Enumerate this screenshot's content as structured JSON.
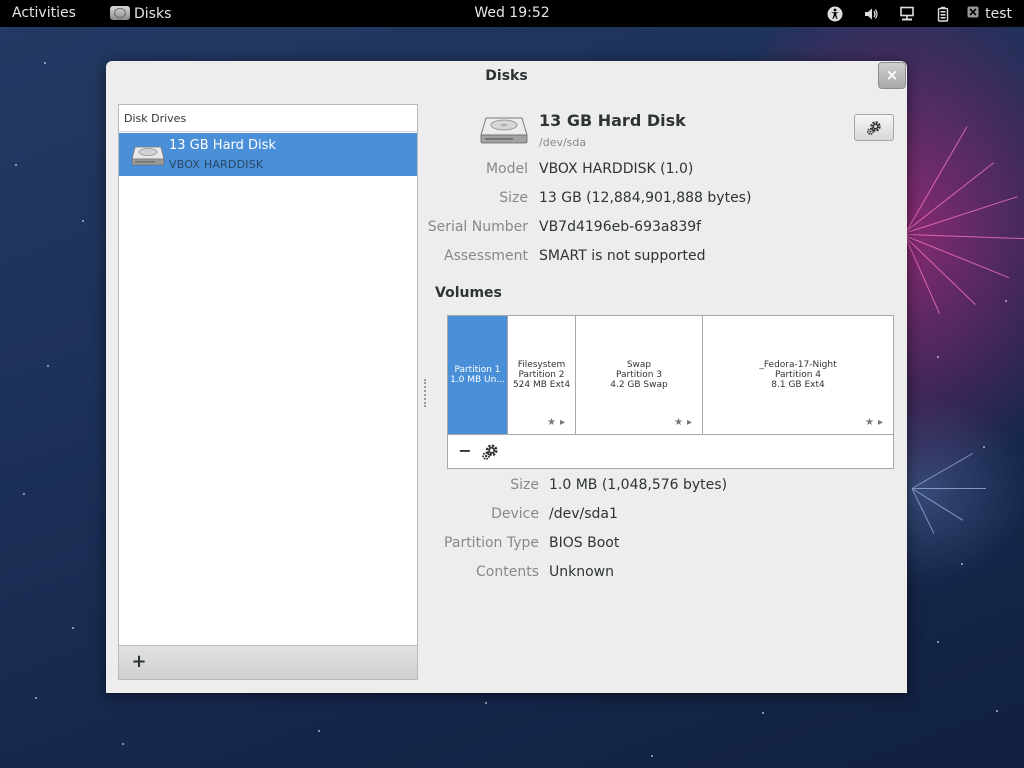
{
  "topbar": {
    "activities": "Activities",
    "app_name": "Disks",
    "clock": "Wed 19:52",
    "user": "test",
    "icons": [
      "accessibility-icon",
      "volume-icon",
      "network-icon",
      "battery-icon"
    ]
  },
  "window": {
    "title": "Disks",
    "close_label": "×"
  },
  "sidebar": {
    "header": "Disk Drives",
    "drives": [
      {
        "name": "13 GB Hard Disk",
        "model": "VBOX HARDDISK"
      }
    ],
    "add_label": "+"
  },
  "drive": {
    "title": "13 GB Hard Disk",
    "device": "/dev/sda",
    "properties": [
      {
        "label": "Model",
        "value": "VBOX HARDDISK (1.0)"
      },
      {
        "label": "Size",
        "value": "13 GB (12,884,901,888 bytes)"
      },
      {
        "label": "Serial Number",
        "value": "VB7d4196eb-693a839f"
      },
      {
        "label": "Assessment",
        "value": "SMART is not supported"
      }
    ]
  },
  "volumes": {
    "title": "Volumes",
    "partitions": [
      {
        "line1": "Partition 1",
        "line2": "1.0 MB Un...",
        "line3": "",
        "selected": true
      },
      {
        "line1": "Filesystem",
        "line2": "Partition 2",
        "line3": "524 MB Ext4",
        "selected": false
      },
      {
        "line1": "Swap",
        "line2": "Partition 3",
        "line3": "4.2 GB Swap",
        "selected": false
      },
      {
        "line1": "_Fedora-17-Night",
        "line2": "Partition 4",
        "line3": "8.1 GB Ext4",
        "selected": false
      }
    ],
    "remove_label": "−",
    "marks": "★▸"
  },
  "volume_details": [
    {
      "label": "Size",
      "value": "1.0 MB (1,048,576 bytes)"
    },
    {
      "label": "Device",
      "value": "/dev/sda1"
    },
    {
      "label": "Partition Type",
      "value": "BIOS Boot"
    },
    {
      "label": "Contents",
      "value": "Unknown"
    }
  ]
}
